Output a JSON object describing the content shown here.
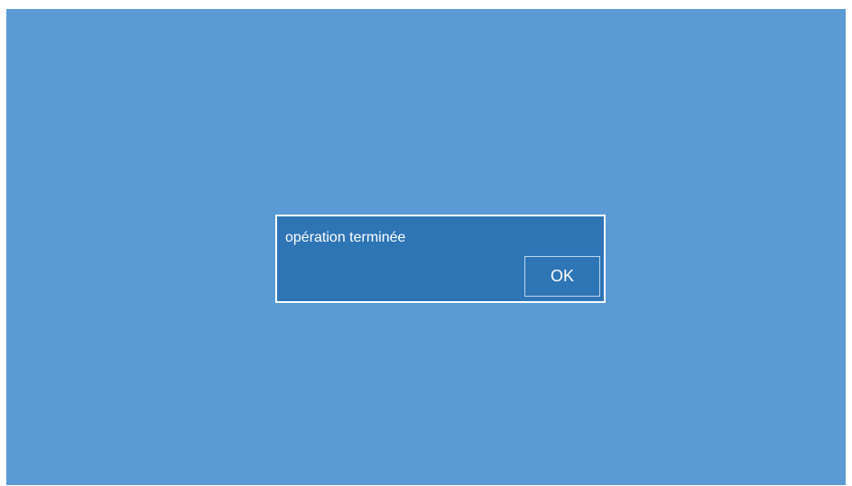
{
  "colors": {
    "screen_background": "#5b9bd5",
    "dialog_background": "#2e75b6",
    "dialog_border": "#ffffff",
    "text": "#ffffff"
  },
  "dialog": {
    "message": "opération terminée",
    "ok_label": "OK"
  }
}
